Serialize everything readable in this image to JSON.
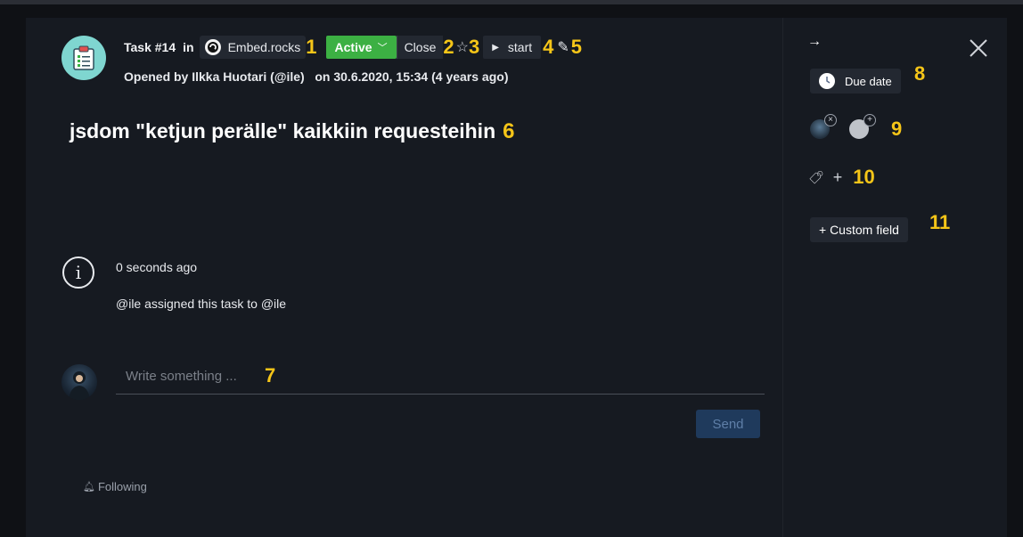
{
  "task": {
    "number": "Task #14",
    "in_word": "in",
    "project": "Embed.rocks",
    "status": "Active",
    "close_label": "Close",
    "star": "☆",
    "start_label": "start",
    "opened_by": "Opened by Ilkka Huotari (@ile)   on 30.6.2020, 15:34 (4 years ago)",
    "title": "jsdom \"ketjun perälle\" kaikkiin requesteihin"
  },
  "activity": {
    "time": "0 seconds ago",
    "message": "@ile assigned this task to @ile"
  },
  "comment": {
    "placeholder": "Write something ...",
    "send_label": "Send"
  },
  "footer": {
    "following_label": "Following"
  },
  "sidebar": {
    "due_date_label": "Due date",
    "custom_field_label": "+ Custom field"
  },
  "markers": {
    "m1": "1",
    "m2": "2",
    "m3": "3",
    "m4": "4",
    "m5": "5",
    "m6": "6",
    "m7": "7",
    "m8": "8",
    "m9": "9",
    "m10": "10",
    "m11": "11"
  },
  "colors": {
    "background": "#161a21",
    "active_status": "#3cb043",
    "marker": "#f5c518",
    "send_button": "#1f3a5c"
  },
  "icons": [
    "clipboard-icon",
    "embed-logo-icon",
    "chevron-down-icon",
    "star-icon",
    "play-icon",
    "pencil-icon",
    "info-icon",
    "bell-icon",
    "arrow-right-icon",
    "close-icon",
    "clock-icon",
    "tag-icon",
    "plus-icon"
  ]
}
